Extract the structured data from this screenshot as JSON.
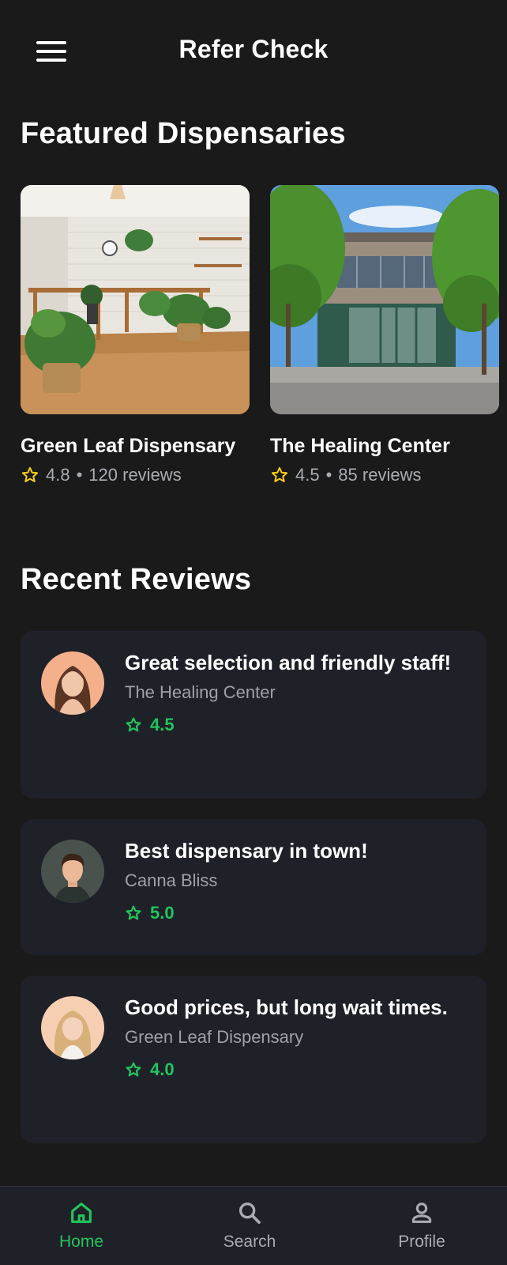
{
  "header": {
    "title": "Refer Check",
    "menu_icon": "hamburger-menu-icon"
  },
  "featured": {
    "title": "Featured Dispensaries",
    "items": [
      {
        "name": "Green Leaf Dispensary",
        "rating": "4.8",
        "reviews": "120 reviews",
        "image": "dispensary-interior-photo"
      },
      {
        "name": "The Healing Center",
        "rating": "4.5",
        "reviews": "85 reviews",
        "image": "dispensary-storefront-photo"
      }
    ]
  },
  "recent": {
    "title": "Recent Reviews",
    "items": [
      {
        "title": "Great selection and friendly staff!",
        "place": "The Healing Center",
        "rating": "4.5",
        "avatar": "woman-avatar"
      },
      {
        "title": "Best dispensary in town!",
        "place": "Canna Bliss",
        "rating": "5.0",
        "avatar": "man-avatar"
      },
      {
        "title": "Good prices, but long wait times.",
        "place": "Green Leaf Dispensary",
        "rating": "4.0",
        "avatar": "blonde-woman-avatar"
      }
    ]
  },
  "nav": {
    "items": [
      {
        "label": "Home",
        "icon": "home-icon",
        "active": true
      },
      {
        "label": "Search",
        "icon": "search-icon",
        "active": false
      },
      {
        "label": "Profile",
        "icon": "profile-icon",
        "active": false
      }
    ]
  },
  "colors": {
    "background": "#1a1a1a",
    "card": "#1f2128",
    "accent_green": "#22c55e",
    "star_yellow": "#facc15",
    "muted_text": "#a9acb2"
  },
  "separator": "•"
}
